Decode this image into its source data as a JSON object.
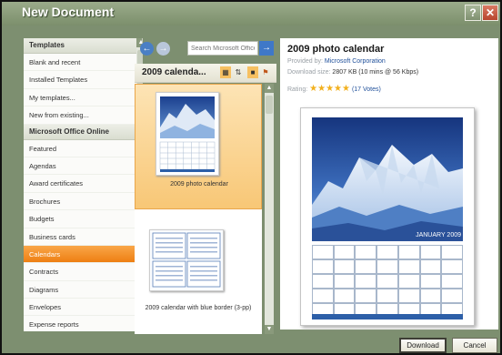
{
  "window": {
    "title": "New Document",
    "help_label": "?",
    "close_label": "✕"
  },
  "sidebar": {
    "section1": "Templates",
    "items1": [
      "Blank and recent",
      "Installed Templates",
      "My templates...",
      "New from existing..."
    ],
    "section2": "Microsoft Office Online",
    "items2": [
      "Featured",
      "Agendas",
      "Award certificates",
      "Brochures",
      "Budgets",
      "Business cards",
      "Calendars",
      "Contracts",
      "Diagrams",
      "Envelopes",
      "Expense reports"
    ],
    "selected": "Calendars"
  },
  "toolbar": {
    "search_placeholder": "Search Microsoft Office",
    "search_go": "→",
    "back": "←",
    "forward": "→"
  },
  "breadcrumb": {
    "label": "2009 calenda...",
    "icons": [
      "sort-icon",
      "view-icon"
    ]
  },
  "thumbnails": [
    {
      "caption": "2009 photo calendar",
      "selected": true
    },
    {
      "caption": "2009 calendar with blue border (3-pp)",
      "selected": false
    }
  ],
  "preview": {
    "title": "2009 photo calendar",
    "provided_label": "Provided by:",
    "provided_value": "Microsoft Corporation",
    "size_label": "Download size:",
    "size_value": "2807 KB (10 mins @ 56 Kbps)",
    "rating_label": "Rating:",
    "rating_stars": 5,
    "votes": "(17 Votes)",
    "month_label": "JANUARY 2009"
  },
  "buttons": {
    "download": "Download",
    "cancel": "Cancel"
  },
  "colors": {
    "accent_selected": "#ee7f12",
    "title_bar": "#8a9c7a",
    "link": "#1f4f9a",
    "star": "#f2b01e"
  }
}
